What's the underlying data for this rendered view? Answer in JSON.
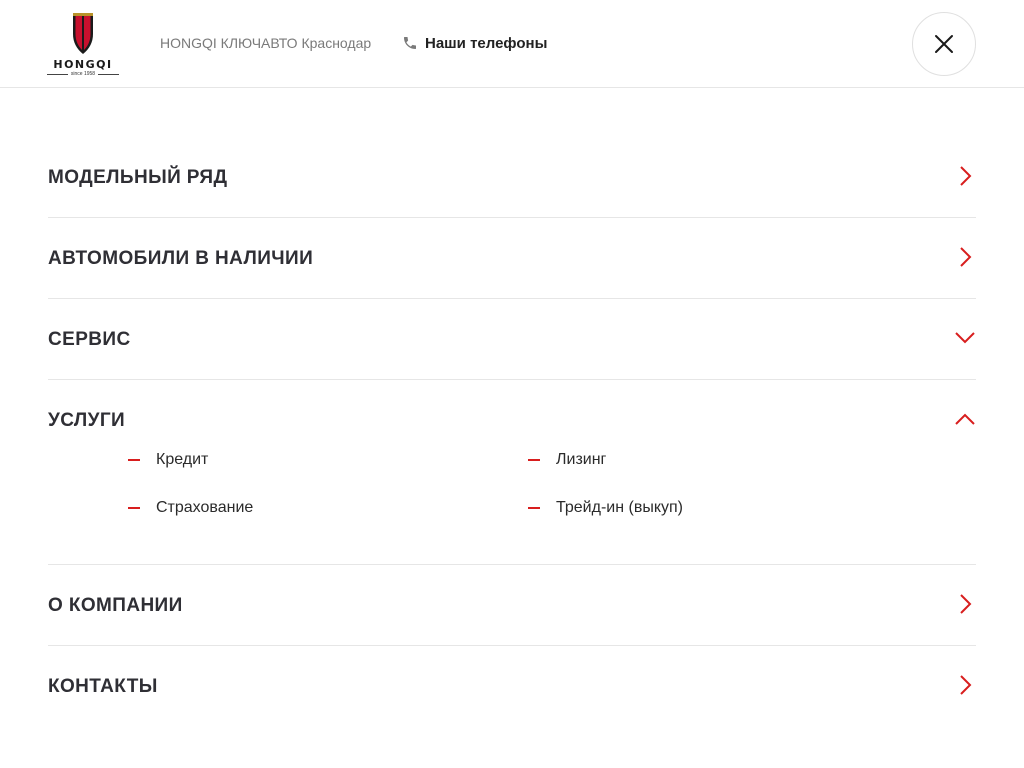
{
  "header": {
    "logo": {
      "word": "HONGQI",
      "tagline": "since 1958"
    },
    "dealer_name": "HONGQI КЛЮЧАВТО Краснодар",
    "phones_label": "Наши телефоны",
    "close_icon": "close-icon",
    "phone_icon": "phone-icon"
  },
  "colors": {
    "accent": "#d81e1e",
    "text": "#2f2f35",
    "muted": "#7a7a7a",
    "divider": "#e6e6e6"
  },
  "menu": {
    "items": [
      {
        "label": "МОДЕЛЬНЫЙ РЯД",
        "icon": "chevron-right-icon",
        "expanded": false
      },
      {
        "label": "АВТОМОБИЛИ В НАЛИЧИИ",
        "icon": "chevron-right-icon",
        "expanded": false
      },
      {
        "label": "СЕРВИС",
        "icon": "chevron-down-icon",
        "expanded": false
      },
      {
        "label": "УСЛУГИ",
        "icon": "chevron-up-icon",
        "expanded": true,
        "children": [
          {
            "label": "Кредит"
          },
          {
            "label": "Лизинг"
          },
          {
            "label": "Страхование"
          },
          {
            "label": "Трейд-ин (выкуп)"
          }
        ]
      },
      {
        "label": "О КОМПАНИИ",
        "icon": "chevron-right-icon",
        "expanded": false
      },
      {
        "label": "КОНТАКТЫ",
        "icon": "chevron-right-icon",
        "expanded": false
      }
    ]
  }
}
